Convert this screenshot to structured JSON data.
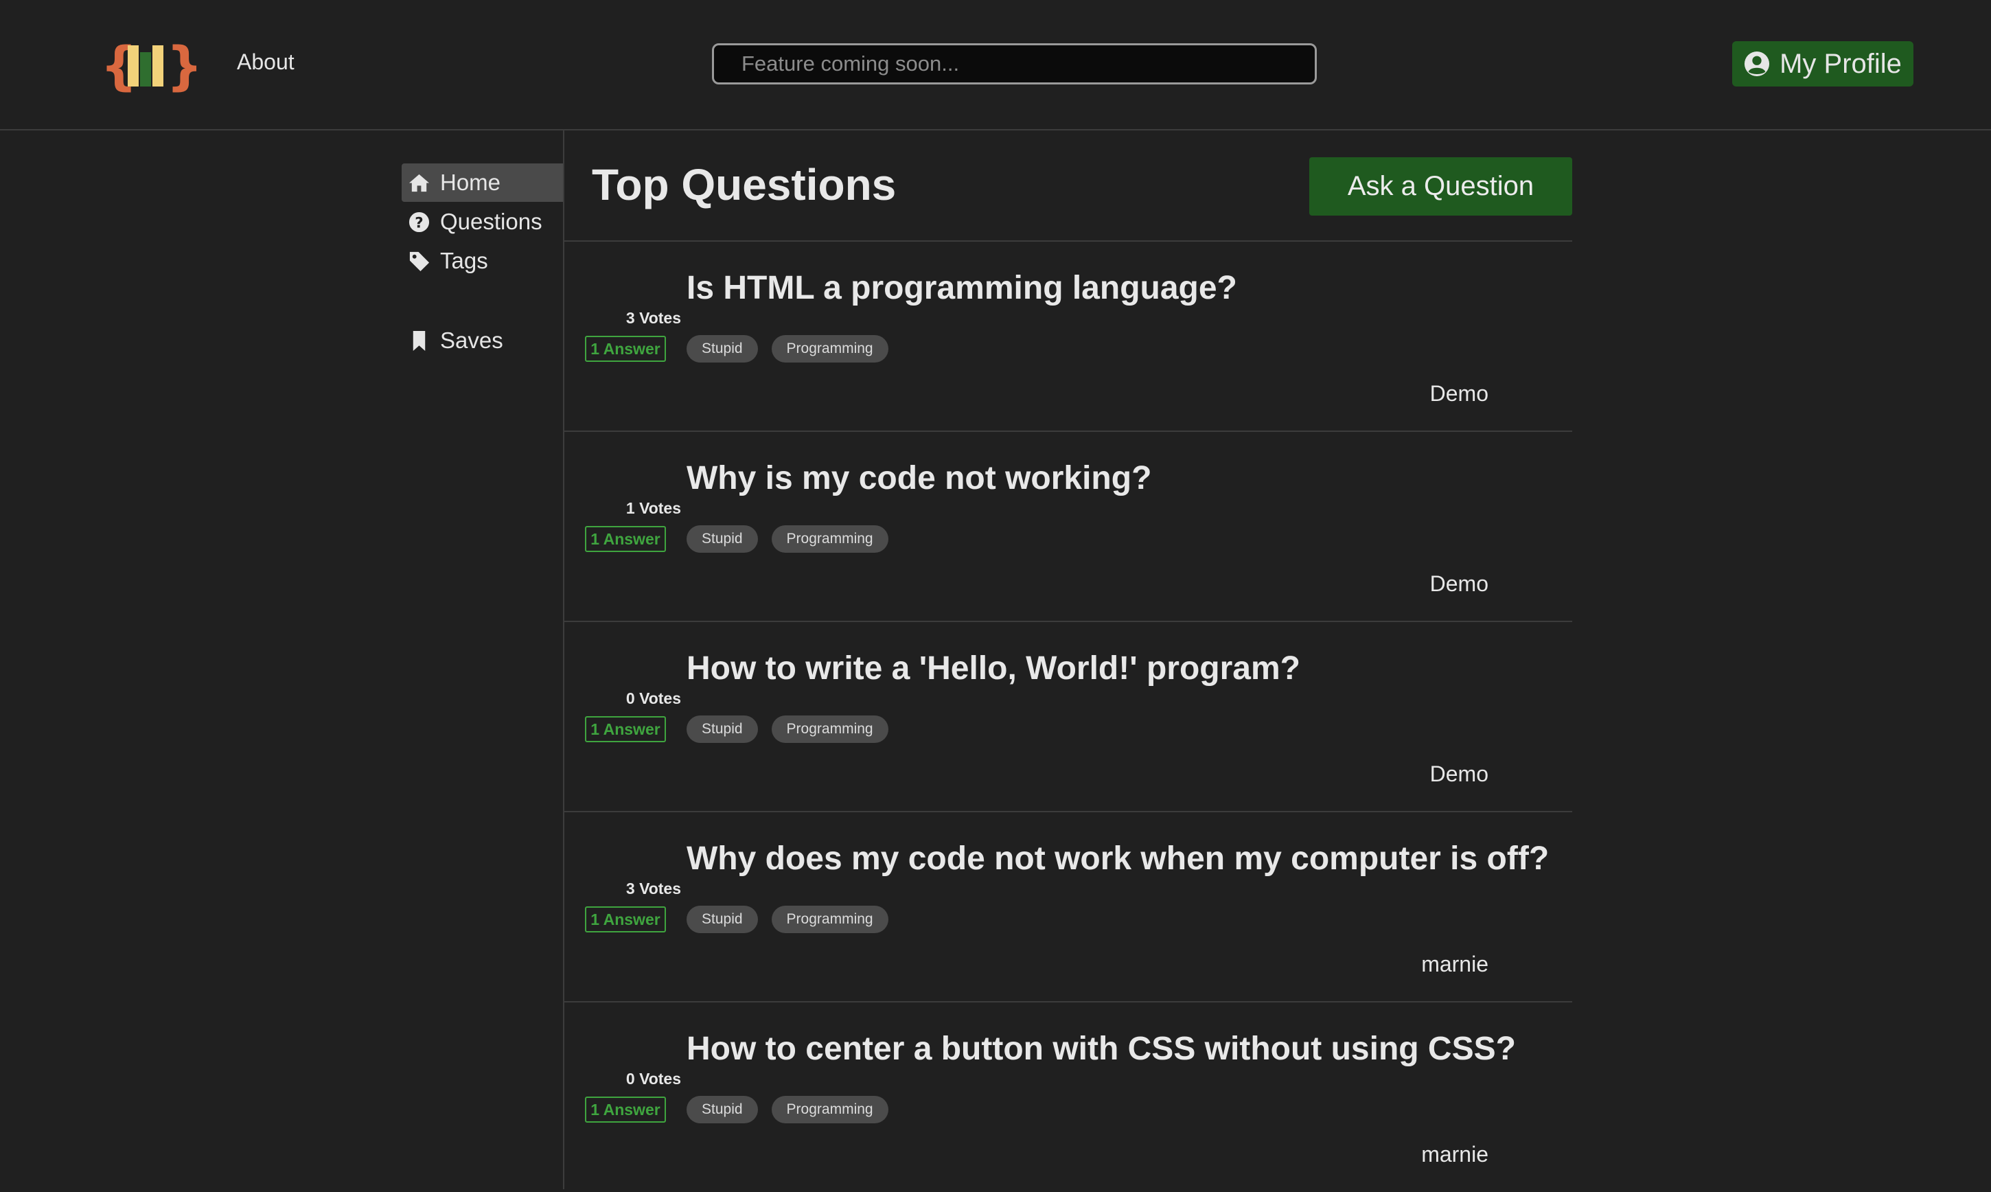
{
  "header": {
    "about_label": "About",
    "search_placeholder": "Feature coming soon...",
    "profile_label": "My Profile"
  },
  "sidebar": {
    "items": [
      {
        "label": "Home",
        "icon": "home-icon",
        "active": true
      },
      {
        "label": "Questions",
        "icon": "question-circle-icon",
        "active": false
      },
      {
        "label": "Tags",
        "icon": "tag-icon",
        "active": false
      },
      {
        "label": "Saves",
        "icon": "bookmark-icon",
        "active": false
      }
    ]
  },
  "main": {
    "title": "Top Questions",
    "ask_label": "Ask a Question",
    "questions": [
      {
        "votes": "3 Votes",
        "answers": "1 Answer",
        "title": "Is HTML a programming language?",
        "tags": [
          "Stupid",
          "Programming"
        ],
        "author": "Demo"
      },
      {
        "votes": "1 Votes",
        "answers": "1 Answer",
        "title": "Why is my code not working?",
        "tags": [
          "Stupid",
          "Programming"
        ],
        "author": "Demo"
      },
      {
        "votes": "0 Votes",
        "answers": "1 Answer",
        "title": "How to write a 'Hello, World!' program?",
        "tags": [
          "Stupid",
          "Programming"
        ],
        "author": "Demo"
      },
      {
        "votes": "3 Votes",
        "answers": "1 Answer",
        "title": "Why does my code not work when my computer is off?",
        "tags": [
          "Stupid",
          "Programming"
        ],
        "author": "marnie"
      },
      {
        "votes": "0 Votes",
        "answers": "1 Answer",
        "title": "How to center a button with CSS without using CSS?",
        "tags": [
          "Stupid",
          "Programming"
        ],
        "author": "marnie"
      }
    ]
  },
  "colors": {
    "background": "#202020",
    "accent_green": "#1f5a1f",
    "answer_green": "#3fa53f",
    "logo_orange": "#d9683f",
    "logo_yellow": "#f2d27a"
  }
}
